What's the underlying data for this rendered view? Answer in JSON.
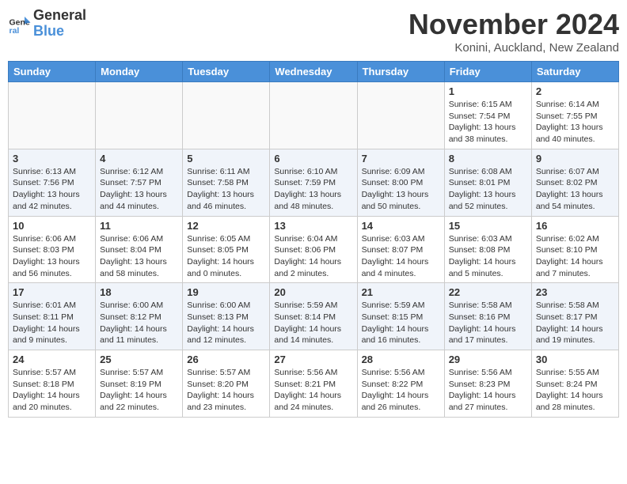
{
  "header": {
    "logo_general": "General",
    "logo_blue": "Blue",
    "month_title": "November 2024",
    "location": "Konini, Auckland, New Zealand"
  },
  "days_of_week": [
    "Sunday",
    "Monday",
    "Tuesday",
    "Wednesday",
    "Thursday",
    "Friday",
    "Saturday"
  ],
  "weeks": [
    [
      {
        "day": "",
        "info": ""
      },
      {
        "day": "",
        "info": ""
      },
      {
        "day": "",
        "info": ""
      },
      {
        "day": "",
        "info": ""
      },
      {
        "day": "",
        "info": ""
      },
      {
        "day": "1",
        "info": "Sunrise: 6:15 AM\nSunset: 7:54 PM\nDaylight: 13 hours\nand 38 minutes."
      },
      {
        "day": "2",
        "info": "Sunrise: 6:14 AM\nSunset: 7:55 PM\nDaylight: 13 hours\nand 40 minutes."
      }
    ],
    [
      {
        "day": "3",
        "info": "Sunrise: 6:13 AM\nSunset: 7:56 PM\nDaylight: 13 hours\nand 42 minutes."
      },
      {
        "day": "4",
        "info": "Sunrise: 6:12 AM\nSunset: 7:57 PM\nDaylight: 13 hours\nand 44 minutes."
      },
      {
        "day": "5",
        "info": "Sunrise: 6:11 AM\nSunset: 7:58 PM\nDaylight: 13 hours\nand 46 minutes."
      },
      {
        "day": "6",
        "info": "Sunrise: 6:10 AM\nSunset: 7:59 PM\nDaylight: 13 hours\nand 48 minutes."
      },
      {
        "day": "7",
        "info": "Sunrise: 6:09 AM\nSunset: 8:00 PM\nDaylight: 13 hours\nand 50 minutes."
      },
      {
        "day": "8",
        "info": "Sunrise: 6:08 AM\nSunset: 8:01 PM\nDaylight: 13 hours\nand 52 minutes."
      },
      {
        "day": "9",
        "info": "Sunrise: 6:07 AM\nSunset: 8:02 PM\nDaylight: 13 hours\nand 54 minutes."
      }
    ],
    [
      {
        "day": "10",
        "info": "Sunrise: 6:06 AM\nSunset: 8:03 PM\nDaylight: 13 hours\nand 56 minutes."
      },
      {
        "day": "11",
        "info": "Sunrise: 6:06 AM\nSunset: 8:04 PM\nDaylight: 13 hours\nand 58 minutes."
      },
      {
        "day": "12",
        "info": "Sunrise: 6:05 AM\nSunset: 8:05 PM\nDaylight: 14 hours\nand 0 minutes."
      },
      {
        "day": "13",
        "info": "Sunrise: 6:04 AM\nSunset: 8:06 PM\nDaylight: 14 hours\nand 2 minutes."
      },
      {
        "day": "14",
        "info": "Sunrise: 6:03 AM\nSunset: 8:07 PM\nDaylight: 14 hours\nand 4 minutes."
      },
      {
        "day": "15",
        "info": "Sunrise: 6:03 AM\nSunset: 8:08 PM\nDaylight: 14 hours\nand 5 minutes."
      },
      {
        "day": "16",
        "info": "Sunrise: 6:02 AM\nSunset: 8:10 PM\nDaylight: 14 hours\nand 7 minutes."
      }
    ],
    [
      {
        "day": "17",
        "info": "Sunrise: 6:01 AM\nSunset: 8:11 PM\nDaylight: 14 hours\nand 9 minutes."
      },
      {
        "day": "18",
        "info": "Sunrise: 6:00 AM\nSunset: 8:12 PM\nDaylight: 14 hours\nand 11 minutes."
      },
      {
        "day": "19",
        "info": "Sunrise: 6:00 AM\nSunset: 8:13 PM\nDaylight: 14 hours\nand 12 minutes."
      },
      {
        "day": "20",
        "info": "Sunrise: 5:59 AM\nSunset: 8:14 PM\nDaylight: 14 hours\nand 14 minutes."
      },
      {
        "day": "21",
        "info": "Sunrise: 5:59 AM\nSunset: 8:15 PM\nDaylight: 14 hours\nand 16 minutes."
      },
      {
        "day": "22",
        "info": "Sunrise: 5:58 AM\nSunset: 8:16 PM\nDaylight: 14 hours\nand 17 minutes."
      },
      {
        "day": "23",
        "info": "Sunrise: 5:58 AM\nSunset: 8:17 PM\nDaylight: 14 hours\nand 19 minutes."
      }
    ],
    [
      {
        "day": "24",
        "info": "Sunrise: 5:57 AM\nSunset: 8:18 PM\nDaylight: 14 hours\nand 20 minutes."
      },
      {
        "day": "25",
        "info": "Sunrise: 5:57 AM\nSunset: 8:19 PM\nDaylight: 14 hours\nand 22 minutes."
      },
      {
        "day": "26",
        "info": "Sunrise: 5:57 AM\nSunset: 8:20 PM\nDaylight: 14 hours\nand 23 minutes."
      },
      {
        "day": "27",
        "info": "Sunrise: 5:56 AM\nSunset: 8:21 PM\nDaylight: 14 hours\nand 24 minutes."
      },
      {
        "day": "28",
        "info": "Sunrise: 5:56 AM\nSunset: 8:22 PM\nDaylight: 14 hours\nand 26 minutes."
      },
      {
        "day": "29",
        "info": "Sunrise: 5:56 AM\nSunset: 8:23 PM\nDaylight: 14 hours\nand 27 minutes."
      },
      {
        "day": "30",
        "info": "Sunrise: 5:55 AM\nSunset: 8:24 PM\nDaylight: 14 hours\nand 28 minutes."
      }
    ]
  ]
}
